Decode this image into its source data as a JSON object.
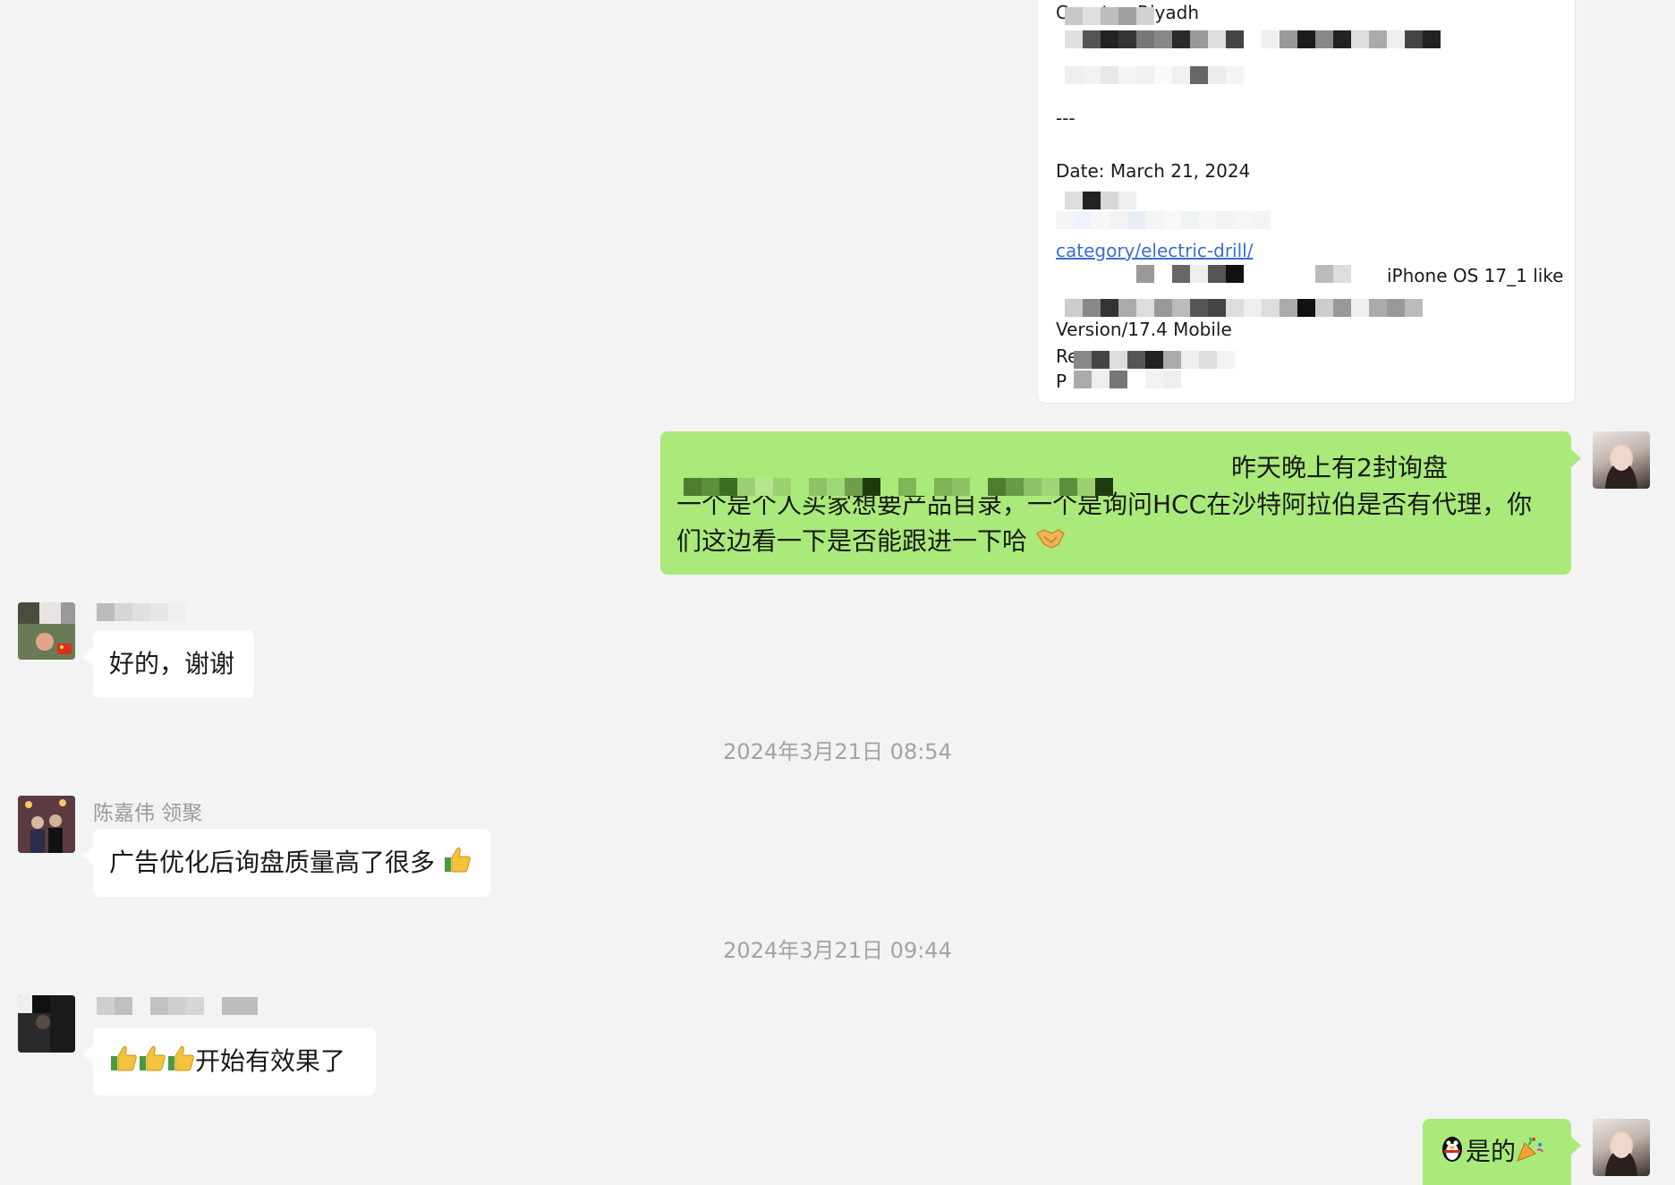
{
  "card": {
    "line1": "Country: Riyadh",
    "separator": "---",
    "date": "Date: March 21, 2024",
    "link": "category/electric-drill/",
    "ua_tail": "iPhone OS 17_1 like",
    "version": "Version/17.4 Mobile",
    "ref_prefix": "Re",
    "p_prefix": "P"
  },
  "messages": {
    "outgoing_1": {
      "line1": "昨天晚上有2封询盘",
      "line2": "一个是个人买家想要产品目录，一个是询问HCC在沙特阿拉伯是否有代理，你",
      "line3": "们这边看一下是否能跟进一下哈"
    },
    "incoming_1": {
      "text": "好的，谢谢"
    },
    "timestamp_1": "2024年3月21日 08:54",
    "incoming_2": {
      "sender": "陈嘉伟 领聚",
      "text": "广告优化后询盘质量高了很多"
    },
    "timestamp_2": "2024年3月21日 09:44",
    "incoming_3": {
      "text": "开始有效果了"
    },
    "outgoing_2": {
      "text": "是的"
    }
  },
  "icons": {
    "handshake": "handshake-emoji",
    "thumbs_up": "thumbs-up-emoji",
    "penguin": "qq-penguin-emoji",
    "party": "party-popper-emoji"
  },
  "colors": {
    "background": "#f3f3f3",
    "outgoing_bubble": "#a9ea7a",
    "incoming_bubble": "#ffffff",
    "link": "#3a6fd0",
    "meta_text": "#a3a3a3"
  }
}
